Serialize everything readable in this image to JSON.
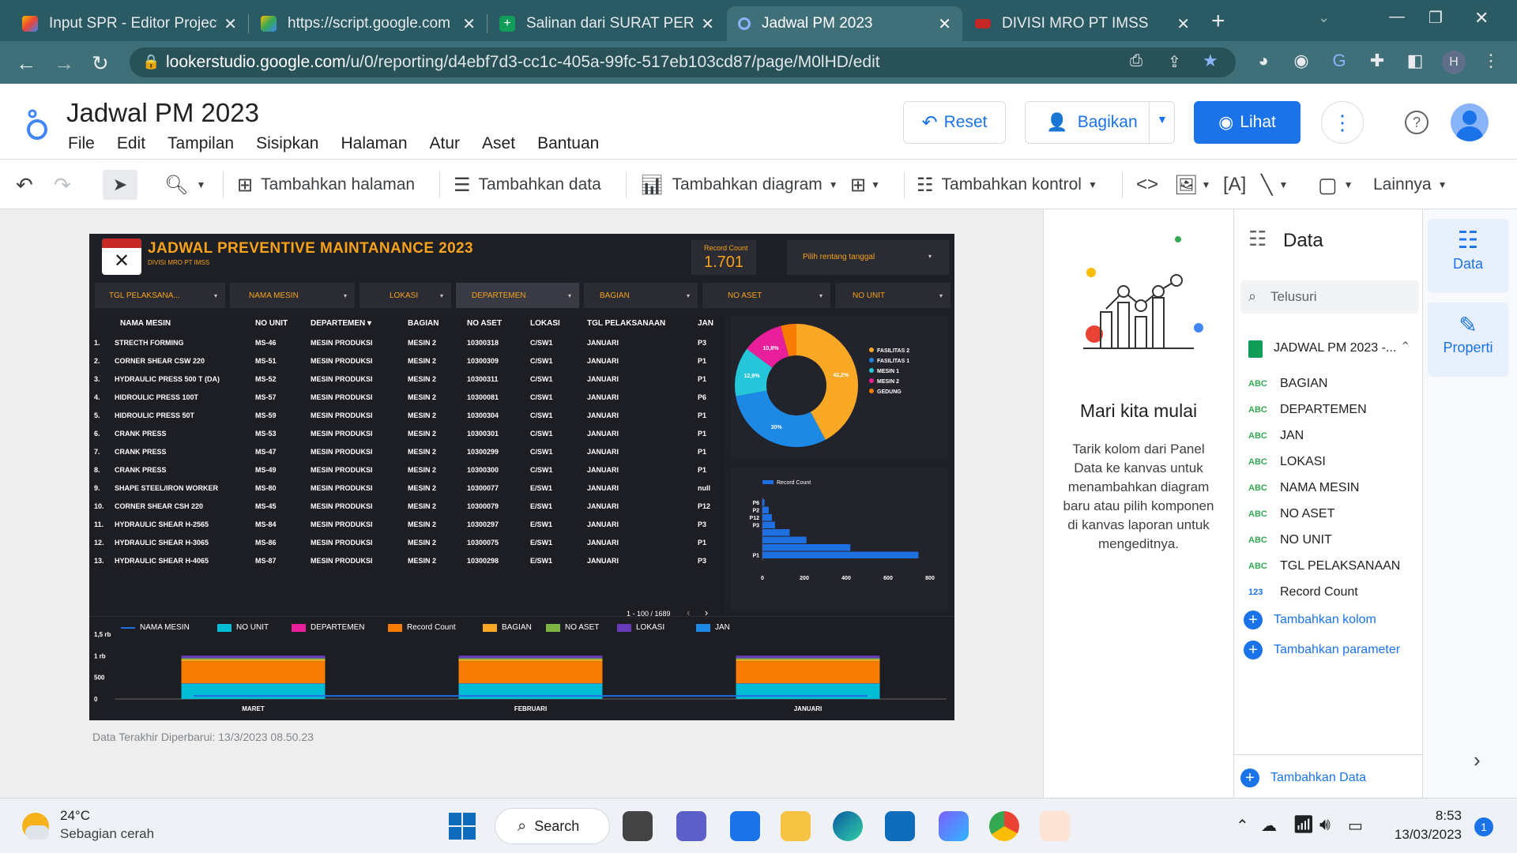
{
  "browser": {
    "tabs": [
      {
        "title": "Input SPR - Editor Project",
        "active": false
      },
      {
        "title": "https://script.google.com",
        "active": false
      },
      {
        "title": "Salinan dari SURAT PERM",
        "active": false
      },
      {
        "title": "Jadwal PM 2023",
        "active": true
      },
      {
        "title": "DIVISI MRO PT IMSS",
        "active": false
      }
    ],
    "new_tab": "+",
    "url_host": "lookerstudio.google.com",
    "url_path": "/u/0/reporting/d4ebf7d3-cc1c-405a-99fc-517eb103cd87/page/M0lHD/edit",
    "profile_initial": "H"
  },
  "app": {
    "title": "Jadwal PM 2023",
    "menu": [
      "File",
      "Edit",
      "Tampilan",
      "Sisipkan",
      "Halaman",
      "Atur",
      "Aset",
      "Bantuan"
    ],
    "reset_label": "Reset",
    "share_label": "Bagikan",
    "view_label": "Lihat"
  },
  "toolbar": {
    "add_page": "Tambahkan halaman",
    "add_data": "Tambahkan data",
    "add_chart": "Tambahkan diagram",
    "add_control": "Tambahkan kontrol",
    "more": "Lainnya"
  },
  "report": {
    "title": "JADWAL PREVENTIVE MAINTANANCE 2023",
    "subtitle": "DIVISI MRO PT IMSS",
    "scorecard_label": "Record Count",
    "scorecard_value": "1.701",
    "date_range": "Pilih rentang tanggal",
    "filters": [
      "TGL PELAKSANA...",
      "NAMA MESIN",
      "LOKASI",
      "DEPARTEMEN",
      "BAGIAN",
      "NO ASET",
      "NO UNIT"
    ],
    "table": {
      "headers": [
        "NAMA MESIN",
        "NO UNIT",
        "DEPARTEMEN",
        "BAGIAN",
        "NO ASET",
        "LOKASI",
        "TGL PELAKSANAAN",
        "JAN"
      ],
      "sort_mark": "▾",
      "rows": [
        [
          "1.",
          "STRECTH FORMING",
          "MS-46",
          "MESIN PRODUKSI",
          "MESIN 2",
          "10300318",
          "C/SW1",
          "JANUARI",
          "P3"
        ],
        [
          "2.",
          "CORNER SHEAR CSW 220",
          "MS-51",
          "MESIN PRODUKSI",
          "MESIN 2",
          "10300309",
          "C/SW1",
          "JANUARI",
          "P1"
        ],
        [
          "3.",
          "HYDRAULIC PRESS 500 T (DA)",
          "MS-52",
          "MESIN PRODUKSI",
          "MESIN 2",
          "10300311",
          "C/SW1",
          "JANUARI",
          "P1"
        ],
        [
          "4.",
          "HIDROULIC PRESS 100T",
          "MS-57",
          "MESIN PRODUKSI",
          "MESIN 2",
          "10300081",
          "C/SW1",
          "JANUARI",
          "P6"
        ],
        [
          "5.",
          "HIDROULIC PRESS 50T",
          "MS-59",
          "MESIN PRODUKSI",
          "MESIN 2",
          "10300304",
          "C/SW1",
          "JANUARI",
          "P1"
        ],
        [
          "6.",
          "CRANK PRESS",
          "MS-53",
          "MESIN PRODUKSI",
          "MESIN 2",
          "10300301",
          "C/SW1",
          "JANUARI",
          "P1"
        ],
        [
          "7.",
          "CRANK PRESS",
          "MS-47",
          "MESIN PRODUKSI",
          "MESIN 2",
          "10300299",
          "C/SW1",
          "JANUARI",
          "P1"
        ],
        [
          "8.",
          "CRANK PRESS",
          "MS-49",
          "MESIN PRODUKSI",
          "MESIN 2",
          "10300300",
          "C/SW1",
          "JANUARI",
          "P1"
        ],
        [
          "9.",
          "SHAPE STEEL/IRON WORKER",
          "MS-80",
          "MESIN PRODUKSI",
          "MESIN 2",
          "10300077",
          "E/SW1",
          "JANUARI",
          "null"
        ],
        [
          "10.",
          "CORNER SHEAR CSH 220",
          "MS-45",
          "MESIN PRODUKSI",
          "MESIN 2",
          "10300079",
          "E/SW1",
          "JANUARI",
          "P12"
        ],
        [
          "11.",
          "HYDRAULIC SHEAR H-2565",
          "MS-84",
          "MESIN PRODUKSI",
          "MESIN 2",
          "10300297",
          "E/SW1",
          "JANUARI",
          "P3"
        ],
        [
          "12.",
          "HYDRAULIC SHEAR H-3065",
          "MS-86",
          "MESIN PRODUKSI",
          "MESIN 2",
          "10300075",
          "E/SW1",
          "JANUARI",
          "P1"
        ],
        [
          "13.",
          "HYDRAULIC SHEAR H-4065",
          "MS-87",
          "MESIN PRODUKSI",
          "MESIN 2",
          "10300298",
          "E/SW1",
          "JANUARI",
          "P3"
        ]
      ],
      "pager": "1 - 100 / 1689"
    },
    "last_updated": "Data Terakhir Diperbarui: 13/3/2023 08.50.23"
  },
  "chart_data": [
    {
      "type": "pie",
      "labels": [
        "FASILITAS 2",
        "FASILITAS 1",
        "MESIN 1",
        "MESIN 2",
        "GEDUNG"
      ],
      "values": [
        42.2,
        30,
        12.9,
        10.8,
        4.1
      ],
      "slice_labels": [
        "42,2%",
        "30%",
        "12,9%",
        "10,8%",
        ""
      ],
      "colors": [
        "#f9a825",
        "#1e88e5",
        "#26c6da",
        "#e91e9b",
        "#f57c00"
      ]
    },
    {
      "type": "bar",
      "orientation": "horizontal",
      "legend": "Record Count",
      "categories": [
        "P6",
        "P2",
        "P12",
        "P3",
        "",
        "",
        "",
        "P1"
      ],
      "values": [
        10,
        30,
        45,
        60,
        130,
        210,
        420,
        745
      ],
      "xlim": [
        0,
        800
      ],
      "xticks": [
        "0",
        "200",
        "400",
        "600",
        "800"
      ],
      "color": "#1e6fe0"
    },
    {
      "type": "bar",
      "stacked": true,
      "categories": [
        "MARET",
        "FEBRUARI",
        "JANUARI"
      ],
      "yticks": [
        "1,5 rb",
        "1 rb",
        "500",
        "0"
      ],
      "ylim": [
        0,
        1500
      ],
      "series": [
        {
          "name": "NAMA MESIN",
          "kind": "line",
          "values": [
            70,
            70,
            70
          ],
          "color": "#1e6fe0"
        },
        {
          "name": "NO UNIT",
          "values": [
            360,
            360,
            360
          ],
          "color": "#00bcd4"
        },
        {
          "name": "DEPARTEMEN",
          "values": [
            5,
            5,
            5
          ],
          "color": "#e91e9b"
        },
        {
          "name": "Record Count",
          "values": [
            510,
            510,
            510
          ],
          "color": "#f57c00"
        },
        {
          "name": "BAGIAN",
          "values": [
            40,
            40,
            40
          ],
          "color": "#f9a825"
        },
        {
          "name": "NO ASET",
          "values": [
            30,
            30,
            30
          ],
          "color": "#7cb342"
        },
        {
          "name": "LOKASI",
          "values": [
            60,
            60,
            60
          ],
          "color": "#673ab7"
        },
        {
          "name": "JAN",
          "values": [
            0,
            0,
            0
          ],
          "color": "#1e88e5"
        }
      ]
    }
  ],
  "empty_panel": {
    "title": "Mari kita mulai",
    "body": "Tarik kolom dari Panel Data ke kanvas untuk menambahkan diagram baru atau pilih komponen di kanvas laporan untuk mengeditnya."
  },
  "data_panel": {
    "title": "Data",
    "search_placeholder": "Telusuri",
    "source": "JADWAL PM 2023 -...",
    "fields": [
      {
        "type": "ABC",
        "name": "BAGIAN"
      },
      {
        "type": "ABC",
        "name": "DEPARTEMEN"
      },
      {
        "type": "ABC",
        "name": "JAN"
      },
      {
        "type": "ABC",
        "name": "LOKASI"
      },
      {
        "type": "ABC",
        "name": "NAMA MESIN"
      },
      {
        "type": "ABC",
        "name": "NO ASET"
      },
      {
        "type": "ABC",
        "name": "NO UNIT"
      },
      {
        "type": "ABC",
        "name": "TGL PELAKSANAAN"
      },
      {
        "type": "123",
        "name": "Record Count"
      }
    ],
    "add_field": "Tambahkan kolom",
    "add_param": "Tambahkan parameter",
    "add_data": "Tambahkan Data"
  },
  "side_tabs": {
    "data": "Data",
    "properties": "Properti"
  },
  "taskbar": {
    "temp": "24°C",
    "weather": "Sebagian cerah",
    "search": "Search",
    "time": "8:53",
    "date": "13/03/2023",
    "notif_count": "1"
  }
}
